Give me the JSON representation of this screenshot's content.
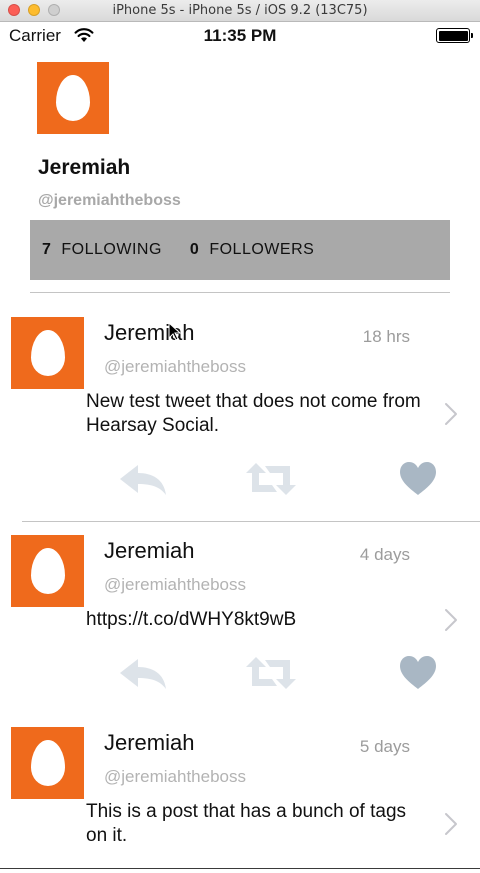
{
  "simulator": {
    "title": "iPhone 5s - iPhone 5s / iOS 9.2 (13C75)"
  },
  "status_bar": {
    "carrier": "Carrier",
    "time": "11:35 PM"
  },
  "profile": {
    "name": "Jeremiah",
    "handle": "@jeremiahtheboss",
    "following_count": "7",
    "following_label": "FOLLOWING",
    "followers_count": "0",
    "followers_label": "FOLLOWERS"
  },
  "tweets": [
    {
      "name": "Jeremiah",
      "handle": "@jeremiahtheboss",
      "time": "18 hrs",
      "text": "New test tweet that does not come from Hearsay Social."
    },
    {
      "name": "Jeremiah",
      "handle": "@jeremiahtheboss",
      "time": "4 days",
      "text": "https://t.co/dWHY8kt9wB"
    },
    {
      "name": "Jeremiah",
      "handle": "@jeremiahtheboss",
      "time": "5 days",
      "text": "This is a post that has a bunch of tags on it."
    }
  ],
  "icons": {
    "avatar": "egg-avatar-icon",
    "reply": "reply-icon",
    "retweet": "retweet-icon",
    "like": "heart-icon",
    "detail": "chevron-right-icon"
  },
  "colors": {
    "avatar_bg": "#ef6a1c",
    "stats_bg": "#a9a9a9",
    "traffic_red": "#fc5f57",
    "traffic_yellow": "#fdbc2e",
    "traffic_green": "#cfcfcf",
    "action_icon": "#dde3e9",
    "heart": "#a9b7c4"
  }
}
